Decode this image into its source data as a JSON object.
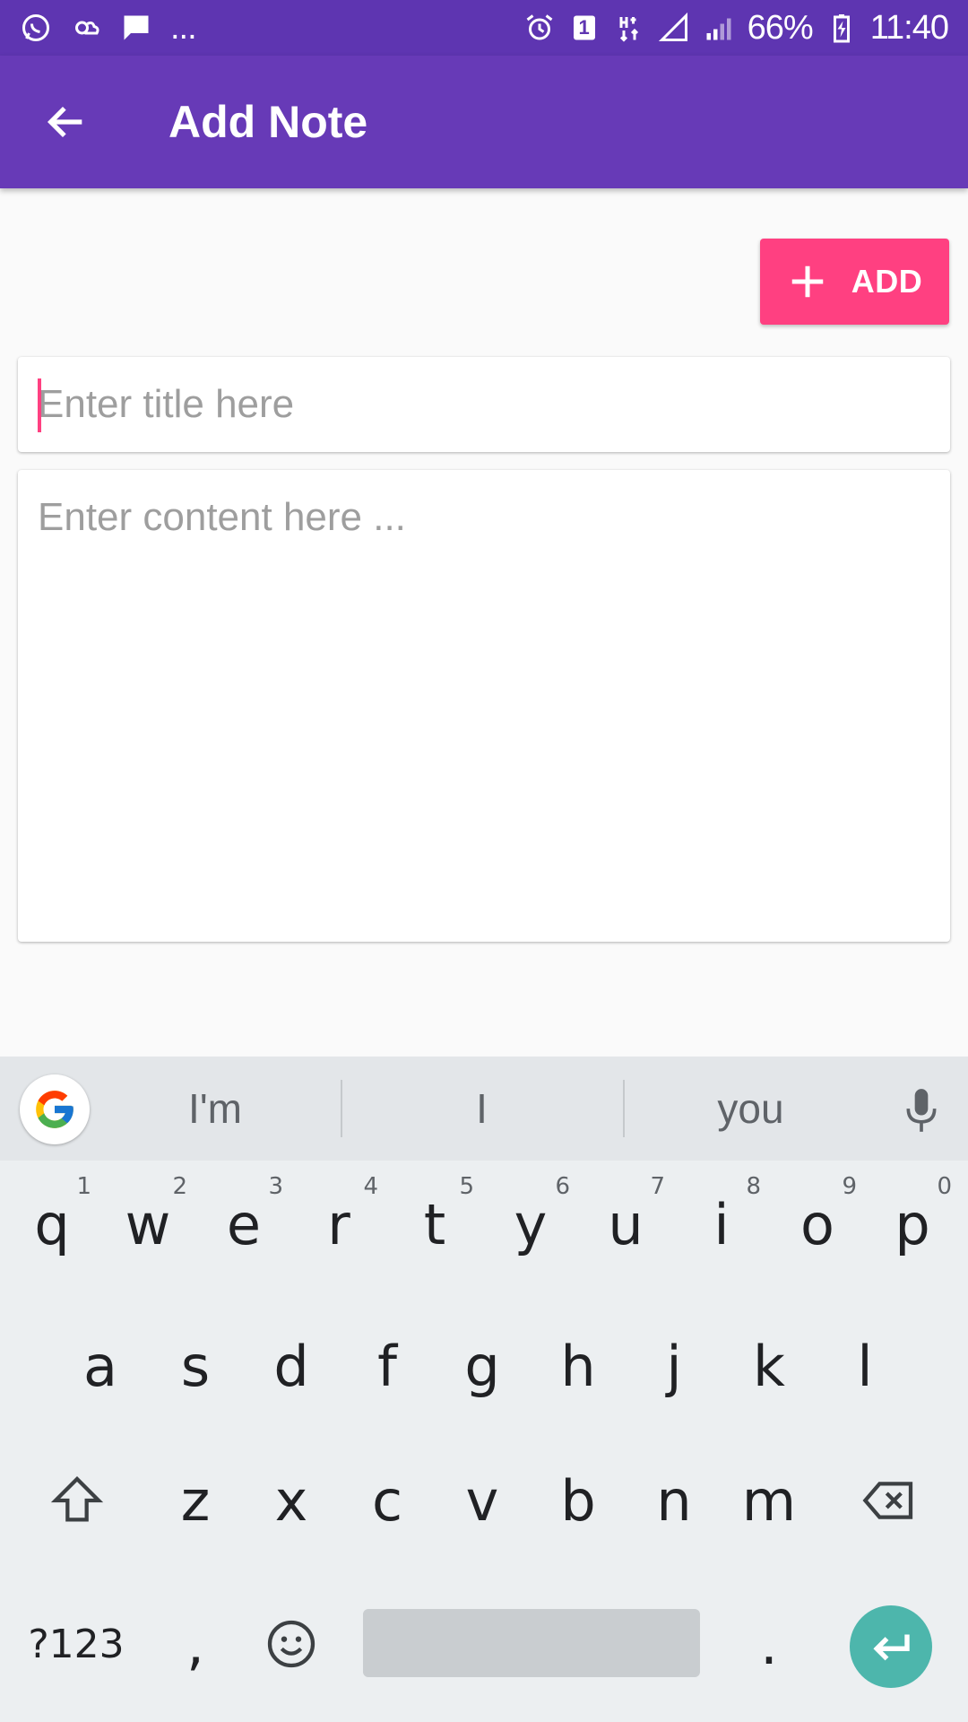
{
  "status_bar": {
    "battery": "66%",
    "time": "11:40",
    "sim_label": "1",
    "more": "..."
  },
  "app_bar": {
    "title": "Add Note"
  },
  "add_button": {
    "label": "ADD"
  },
  "form": {
    "title_placeholder": "Enter title here",
    "content_placeholder": "Enter content here ..."
  },
  "keyboard": {
    "suggestions": [
      "I'm",
      "I",
      "you"
    ],
    "row1": [
      {
        "key": "q",
        "hint": "1"
      },
      {
        "key": "w",
        "hint": "2"
      },
      {
        "key": "e",
        "hint": "3"
      },
      {
        "key": "r",
        "hint": "4"
      },
      {
        "key": "t",
        "hint": "5"
      },
      {
        "key": "y",
        "hint": "6"
      },
      {
        "key": "u",
        "hint": "7"
      },
      {
        "key": "i",
        "hint": "8"
      },
      {
        "key": "o",
        "hint": "9"
      },
      {
        "key": "p",
        "hint": "0"
      }
    ],
    "row2": [
      "a",
      "s",
      "d",
      "f",
      "g",
      "h",
      "j",
      "k",
      "l"
    ],
    "row3": [
      "z",
      "x",
      "c",
      "v",
      "b",
      "n",
      "m"
    ],
    "symbols_label": "?123",
    "comma": ",",
    "period": "."
  },
  "colors": {
    "status_bar": "#5E35B1",
    "app_bar": "#673AB7",
    "accent": "#FF4081",
    "enter_key": "#4DB6AC"
  }
}
